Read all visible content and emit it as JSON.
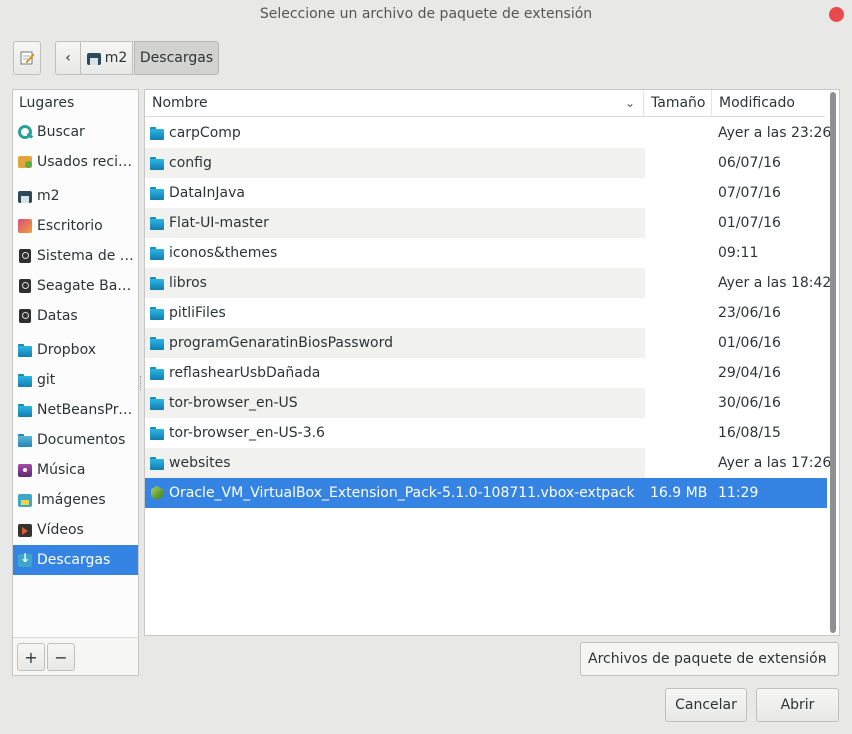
{
  "window": {
    "title": "Seleccione un archivo de paquete de extensión"
  },
  "pathbar": {
    "home_label": "m2",
    "current_label": "Descargas"
  },
  "sidebar": {
    "title": "Lugares",
    "items": [
      {
        "label": "Buscar",
        "icon": "search-icon"
      },
      {
        "label": "Usados recientemente",
        "icon": "recent-icon"
      },
      {
        "label": "m2",
        "icon": "home-icon"
      },
      {
        "label": "Escritorio",
        "icon": "desktop-icon"
      },
      {
        "label": "Sistema de archivos",
        "icon": "drive-icon"
      },
      {
        "label": "Seagate Backup Plus Drive",
        "icon": "drive-icon"
      },
      {
        "label": "Datas",
        "icon": "drive-icon"
      },
      {
        "label": "Dropbox",
        "icon": "folder-icon"
      },
      {
        "label": "git",
        "icon": "folder-icon"
      },
      {
        "label": "NetBeansProjects",
        "icon": "folder-icon"
      },
      {
        "label": "Documentos",
        "icon": "documents-icon"
      },
      {
        "label": "Música",
        "icon": "music-icon"
      },
      {
        "label": "Imágenes",
        "icon": "images-icon"
      },
      {
        "label": "Vídeos",
        "icon": "videos-icon"
      },
      {
        "label": "Descargas",
        "icon": "downloads-icon",
        "active": true
      }
    ],
    "add_label": "+",
    "remove_label": "−"
  },
  "filelist": {
    "columns": {
      "name": "Nombre",
      "size": "Tamaño",
      "modified": "Modificado"
    },
    "rows": [
      {
        "name": "carpComp",
        "size": "",
        "modified": "Ayer a las 23:26",
        "type": "folder"
      },
      {
        "name": "config",
        "size": "",
        "modified": "06/07/16",
        "type": "folder"
      },
      {
        "name": "DataInJava",
        "size": "",
        "modified": "07/07/16",
        "type": "folder"
      },
      {
        "name": "Flat-UI-master",
        "size": "",
        "modified": "01/07/16",
        "type": "folder"
      },
      {
        "name": "iconos&themes",
        "size": "",
        "modified": "09:11",
        "type": "folder"
      },
      {
        "name": "libros",
        "size": "",
        "modified": "Ayer a las 18:42",
        "type": "folder"
      },
      {
        "name": "pitliFiles",
        "size": "",
        "modified": "23/06/16",
        "type": "folder"
      },
      {
        "name": "programGenaratinBiosPassword",
        "size": "",
        "modified": "01/06/16",
        "type": "folder"
      },
      {
        "name": "reflashearUsbDañada",
        "size": "",
        "modified": "29/04/16",
        "type": "folder"
      },
      {
        "name": "tor-browser_en-US",
        "size": "",
        "modified": "30/06/16",
        "type": "folder"
      },
      {
        "name": "tor-browser_en-US-3.6",
        "size": "",
        "modified": "16/08/15",
        "type": "folder"
      },
      {
        "name": "websites",
        "size": "",
        "modified": "Ayer a las 17:26",
        "type": "folder"
      },
      {
        "name": "Oracle_VM_VirtualBox_Extension_Pack-5.1.0-108711.vbox-extpack",
        "size": "16.9 MB",
        "modified": "11:29",
        "type": "package",
        "selected": true
      }
    ]
  },
  "filter": {
    "selected": "Archivos de paquete de extensión"
  },
  "actions": {
    "cancel": "Cancelar",
    "open": "Abrir"
  },
  "colors": {
    "accent": "#3584e4",
    "close": "#e8494a"
  }
}
